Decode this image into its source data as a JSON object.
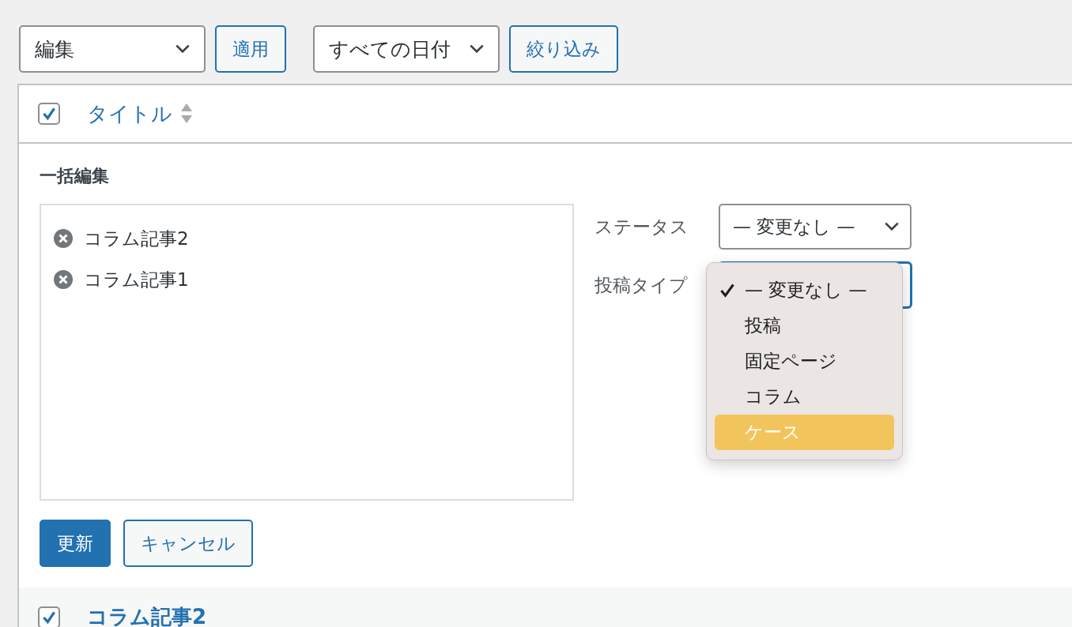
{
  "toolbar": {
    "bulk_action": "編集",
    "apply": "適用",
    "date_filter": "すべての日付",
    "filter": "絞り込み"
  },
  "table_header": {
    "checked": true,
    "title": "タイトル"
  },
  "bulk_edit": {
    "heading": "一括編集",
    "posts": [
      {
        "title": "コラム記事2"
      },
      {
        "title": "コラム記事1"
      }
    ],
    "status": {
      "label": "ステータス",
      "value": "— 変更なし —"
    },
    "post_type": {
      "label": "投稿タイプ",
      "options": [
        {
          "label": "— 変更なし —",
          "selected": true,
          "highlighted": false
        },
        {
          "label": "投稿",
          "selected": false,
          "highlighted": false
        },
        {
          "label": "固定ページ",
          "selected": false,
          "highlighted": false
        },
        {
          "label": "コラム",
          "selected": false,
          "highlighted": false
        },
        {
          "label": "ケース",
          "selected": false,
          "highlighted": true
        }
      ]
    },
    "update": "更新",
    "cancel": "キャンセル"
  },
  "row": {
    "checked": true,
    "title": "コラム記事2"
  }
}
